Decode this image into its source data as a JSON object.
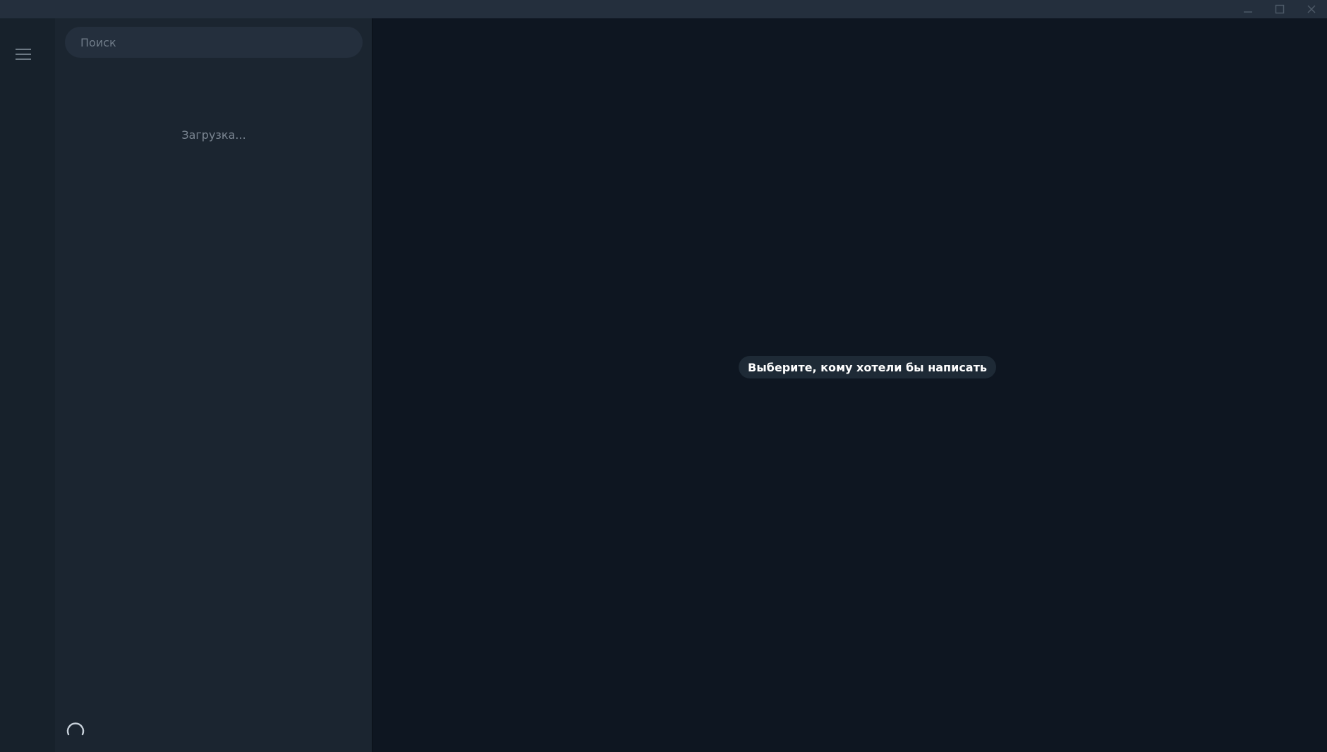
{
  "window": {
    "controls": [
      {
        "icon": "minimize-icon"
      },
      {
        "icon": "maximize-icon"
      },
      {
        "icon": "close-icon"
      }
    ]
  },
  "sidebar": {
    "menu_icon": "hamburger-menu-icon",
    "search": {
      "placeholder": "Поиск",
      "value": ""
    },
    "loading_text": "Загрузка...",
    "spinner_icon": "loading-spinner-icon"
  },
  "main": {
    "empty_state_text": "Выберите, кому хотели бы написать"
  },
  "colors": {
    "titlebar": "#242f3d",
    "rail": "#17212b",
    "chat_list": "#1b2530",
    "conversation": "#0e1621",
    "hint_bg": "#1e2a36"
  }
}
